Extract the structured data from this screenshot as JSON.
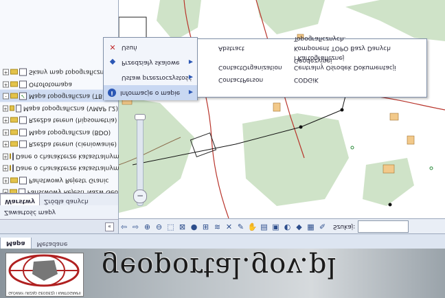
{
  "layers": [
    {
      "label": "Skany map topograficznych",
      "toggle": "+",
      "checked": false
    },
    {
      "label": "Ortofotomapa",
      "toggle": "+",
      "checked": false
    },
    {
      "label": "Mapa topograficzna (TBD)",
      "toggle": "-",
      "checked": true,
      "selected": true
    },
    {
      "label": "Mapa topograficzna (VMAP L2)",
      "toggle": "+",
      "checked": false
    },
    {
      "label": "Rzeźba terenu (hipsometria)",
      "toggle": "+",
      "checked": false
    },
    {
      "label": "Mapa topograficzna (BDO)",
      "toggle": "+",
      "checked": false
    },
    {
      "label": "Rzeźba terenu (cieniowanie)",
      "toggle": "+",
      "checked": false
    },
    {
      "label": "Dane o charakterze katastralnym",
      "toggle": "+",
      "checked": false
    },
    {
      "label": "Dane o charakterze katastralnym",
      "toggle": "+",
      "checked": false
    },
    {
      "label": "Państwowy Rejestr Granic",
      "toggle": "+",
      "checked": false
    },
    {
      "label": "Państwowy Rejestr Nazw Geo",
      "toggle": "+",
      "checked": false
    }
  ],
  "left_tabs": [
    {
      "label": "Warstwy",
      "active": true
    },
    {
      "label": "Źródła danych",
      "active": false
    }
  ],
  "content_header": "Zawartość mapy",
  "collapse_glyph": "«",
  "zoom_minus": "−",
  "context_menu": [
    {
      "icon": "✕",
      "label": "Usuń",
      "arrow": ""
    },
    {
      "icon": "◆",
      "label": "Przedziały skalowe",
      "arrow": "▶"
    },
    {
      "icon": "",
      "label": "Ustaw przezroczystość",
      "arrow": "▶"
    },
    {
      "icon": "i",
      "label": "Informacje o mapie",
      "arrow": "▶",
      "active": true
    }
  ],
  "submenu": [
    {
      "key": "",
      "value": "Topograficznych."
    },
    {
      "key": "Abstract",
      "value": "Komponent TOPO Bazy Danych"
    },
    {
      "key": "",
      "value": "i Kartograficznej"
    },
    {
      "key": "ContactOrganization",
      "value": "Centralny Ośrodek Dokumentacji Geodezyjnej"
    },
    {
      "key": "ContactPerson",
      "value": "CODGiK"
    }
  ],
  "toolbar": {
    "icons": [
      "⇦",
      "⇨",
      "⊕",
      "⊖",
      "⬚",
      "⊠",
      "●",
      "⊞",
      "≋",
      "✕",
      "✎",
      "✋",
      "▤",
      "▣",
      "◐",
      "◆",
      "▦",
      "✐"
    ],
    "search_label": "Szukaj:",
    "search_value": ""
  },
  "bottom_tabs": [
    {
      "label": "Mapa",
      "active": true
    },
    {
      "label": "Metadane",
      "active": false
    }
  ],
  "banner": {
    "title": "geoportal.gov.pl",
    "logo_caption": "GŁÓWNY URZĄD GEODEZJI I KARTOGRAFII"
  },
  "colors": {
    "forest": "#cfe3c8",
    "building": "#f2c98a",
    "road_red": "#b8332a",
    "accent": "#2b57b5"
  }
}
